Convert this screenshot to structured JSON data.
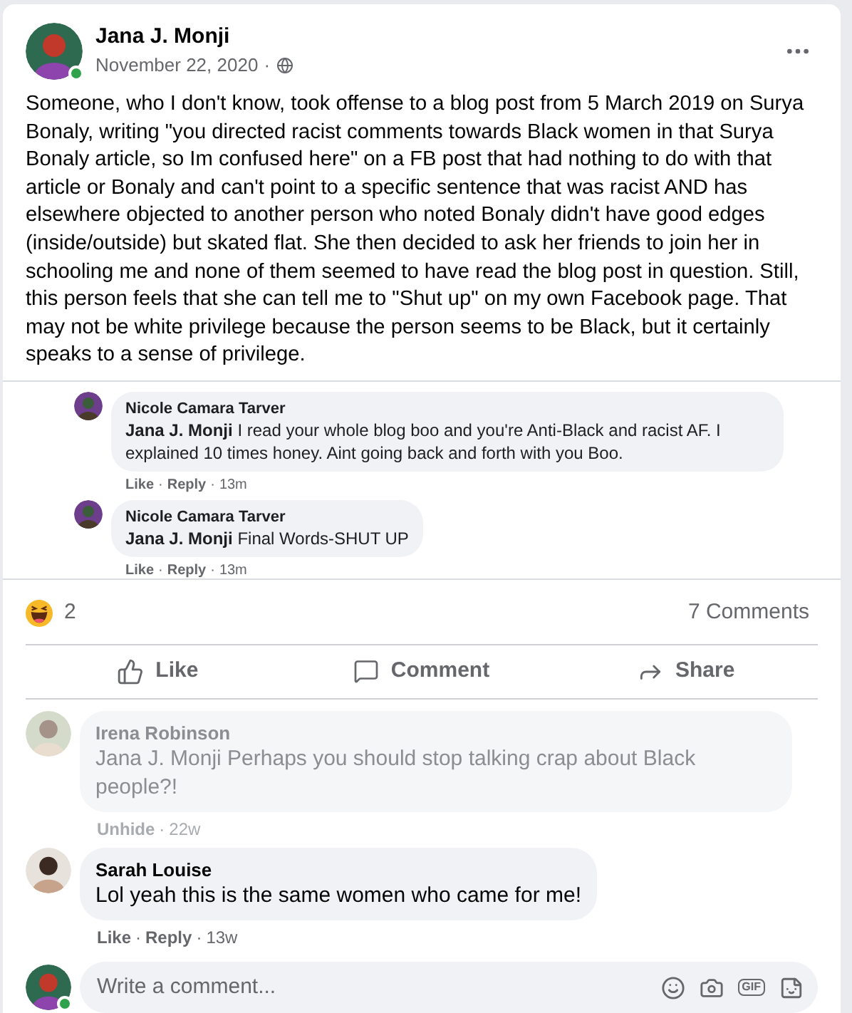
{
  "post": {
    "author": "Jana J. Monji",
    "online": true,
    "date": "November 22, 2020",
    "separator": "·",
    "text": "Someone, who I don't know, took offense to a blog post from 5 March 2019 on Surya Bonaly, writing \"you directed racist comments towards Black women in that Surya Bonaly article, so Im confused here\" on a FB post that had nothing to do with that article or Bonaly and can't point to a specific sentence that was racist AND has elsewhere objected to another person who noted Bonaly didn't have good edges (inside/outside) but skated flat. She then decided to ask her friends to join her in schooling me and none of them seemed to have read the blog post in question. Still, this person feels that she can tell me to \"Shut up\" on my own Facebook page. That may not be white privilege because the person seems to be Black, but it certainly speaks to a sense of privilege."
  },
  "embedded_screenshot": {
    "comments": [
      {
        "author": "Nicole Camara Tarver",
        "text": "**Jana J. Monji** I read your whole blog boo and you're Anti-Black and racist AF. I explained 10 times honey. Aint going back and forth with you Boo.",
        "actions": [
          "Like",
          "Reply"
        ],
        "separator": "·",
        "time": "13m"
      },
      {
        "author": "Nicole Camara Tarver",
        "text": "**Jana J. Monji** Final Words-SHUT UP",
        "actions": [
          "Like",
          "Reply"
        ],
        "separator": "·",
        "time": "13m"
      }
    ]
  },
  "reactions": {
    "count": "2",
    "comments": "7 Comments"
  },
  "actions": [
    {
      "kind": "like",
      "label": "Like"
    },
    {
      "kind": "comment",
      "label": "Comment"
    },
    {
      "kind": "share",
      "label": "Share"
    }
  ],
  "comments": [
    {
      "author": "Irena Robinson",
      "text": "Jana J. Monji Perhaps you should stop talking crap about Black people?!",
      "hidden": true,
      "actions": [
        "Unhide"
      ],
      "separator": "·",
      "time": "22w"
    },
    {
      "author": "Sarah Louise",
      "text": "Lol yeah this is the same women who came for me!",
      "hidden": false,
      "actions": [
        "Like",
        "Reply"
      ],
      "separator": "·",
      "time": "13w"
    }
  ],
  "composer": {
    "placeholder": "Write a comment...",
    "online": true,
    "gif_label": "GIF"
  }
}
